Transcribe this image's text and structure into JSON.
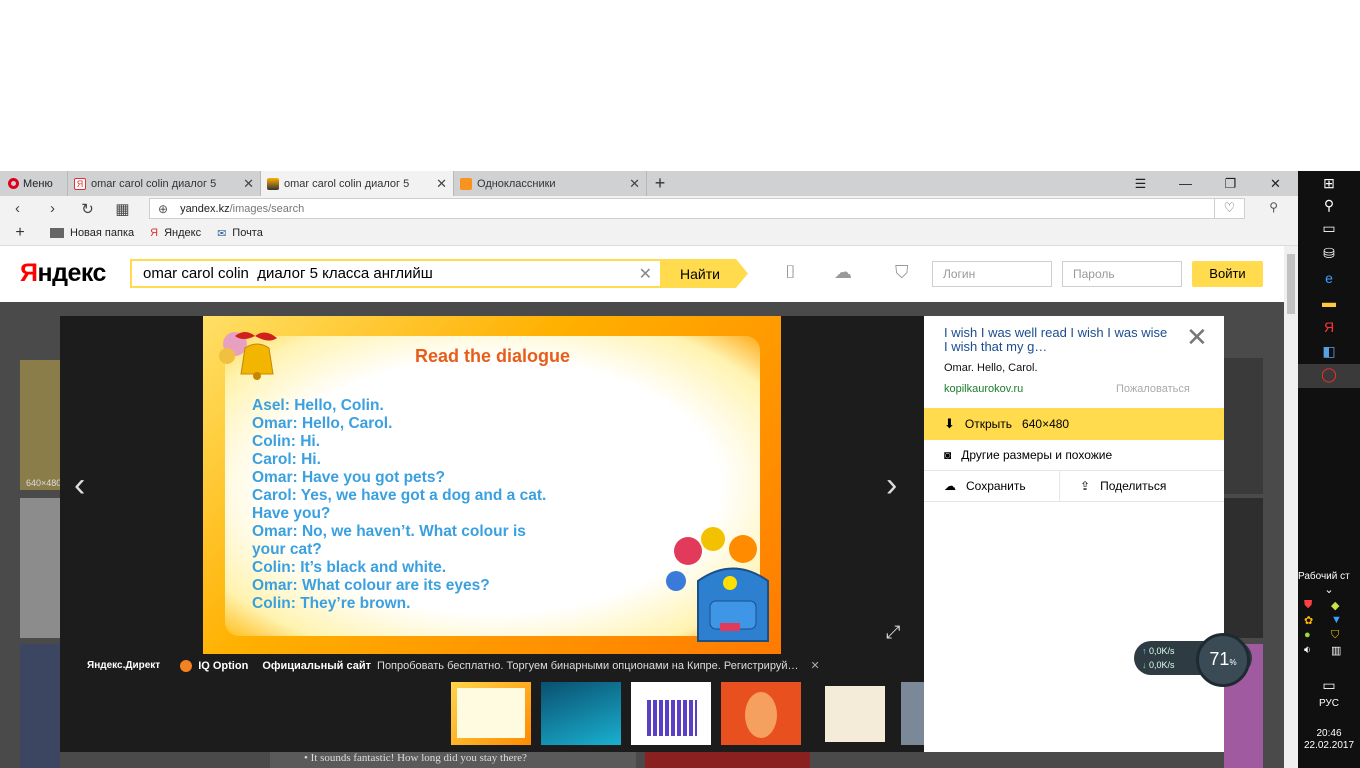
{
  "browser": {
    "menu_label": "Меню",
    "tabs": [
      {
        "title": "omar carol colin диалог 5"
      },
      {
        "title": "omar carol colin диалог 5"
      },
      {
        "title": "Одноклассники"
      }
    ],
    "address": {
      "host": "yandex.kz",
      "path": "/images/search"
    },
    "bookmarks": [
      "Новая папка",
      "Яндекс",
      "Почта"
    ]
  },
  "yandex": {
    "logo_ya": "Я",
    "logo_rest": "ндекс",
    "search_query": "omar carol colin  диалог 5 класса английш",
    "find_label": "Найти",
    "login_placeholder": "Логин",
    "password_placeholder": "Пароль",
    "login_button": "Войти"
  },
  "viewer": {
    "image_title": "Read the dialogue",
    "dialogue_lines": [
      "Asel: Hello, Colin.",
      "Omar: Hello, Carol.",
      "Colin: Hi.",
      "Carol: Hi.",
      "Omar: Have you got pets?",
      "Carol: Yes, we have got a dog and a cat.",
      "Have you?",
      "Omar: No, we haven’t. What colour is",
      "your cat?",
      "Colin: It’s black and white.",
      "Omar: What colour are its eyes?",
      "Colin: They’re brown."
    ],
    "ad": {
      "source": "Яндекс.Директ",
      "brand": "IQ Option",
      "headline": "Официальный сайт",
      "text": "Попробовать бесплатно. Торгуем бинарными опционами на Кипре. Регистрируй…"
    }
  },
  "side_panel": {
    "title": "I wish I was well read I wish I was wise I wish that my g…",
    "description": "Omar. Hello, Carol.",
    "host": "kopilkaurokov.ru",
    "report": "Пожаловаться",
    "open_label": "Открыть",
    "open_size": "640×480",
    "other_sizes": "Другие размеры и похожие",
    "save": "Сохранить",
    "share": "Поделиться"
  },
  "background": {
    "thumb_label": "640×480",
    "snippet": "It sounds fantastic! How long did you stay there?"
  },
  "netmeter": {
    "upload": "0,0K/s",
    "download": "0,0K/s",
    "cpu": "71",
    "cpu_unit": "%"
  },
  "taskbar": {
    "desktop_label": "Рабочий ст",
    "lang": "РУС",
    "time": "20:46",
    "date": "22.02.2017"
  },
  "colors": {
    "yandex_yellow": "#ffdb4d",
    "link_blue": "#1a4d8f",
    "host_green": "#1b7d2c",
    "dialogue_blue": "#3aa0e0",
    "title_orange": "#e85d1a"
  }
}
